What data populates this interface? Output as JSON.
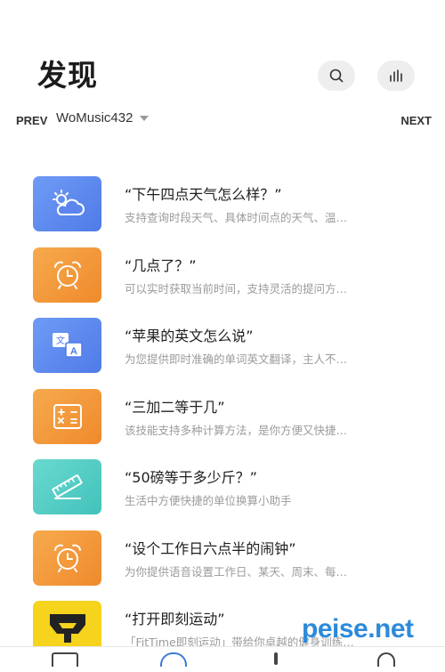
{
  "header": {
    "title": "发现"
  },
  "nav": {
    "prev_label": "PREV",
    "next_label": "NEXT",
    "device_name": "WoMusic432"
  },
  "items": [
    {
      "title": "“下午四点天气怎么样？”",
      "desc": "支持查询时段天气、具体时间点的天气、温…",
      "icon": "weather-icon",
      "color": "blue"
    },
    {
      "title": "“几点了？”",
      "desc": "可以实时获取当前时间，支持灵活的提问方…",
      "icon": "alarm-clock-icon",
      "color": "orange"
    },
    {
      "title": "“苹果的英文怎么说”",
      "desc": "为您提供即时准确的单词英文翻译，主人不…",
      "icon": "translate-icon",
      "color": "blue"
    },
    {
      "title": "“三加二等于几”",
      "desc": "该技能支持多种计算方法，是你方便又快捷…",
      "icon": "calculator-icon",
      "color": "orange"
    },
    {
      "title": "“50磅等于多少斤？”",
      "desc": "生活中方便快捷的单位换算小助手",
      "icon": "ruler-icon",
      "color": "teal"
    },
    {
      "title": "“设个工作日六点半的闹钟”",
      "desc": "为你提供语音设置工作日、某天、周末、每…",
      "icon": "alarm-clock-icon",
      "color": "orange"
    },
    {
      "title": "“打开即刻运动”",
      "desc": "「FitTime即刻运动」带给你卓越的健身训练…",
      "icon": "fittime-logo-icon",
      "color": "yellow"
    }
  ],
  "watermark": {
    "text": "peise.net"
  }
}
